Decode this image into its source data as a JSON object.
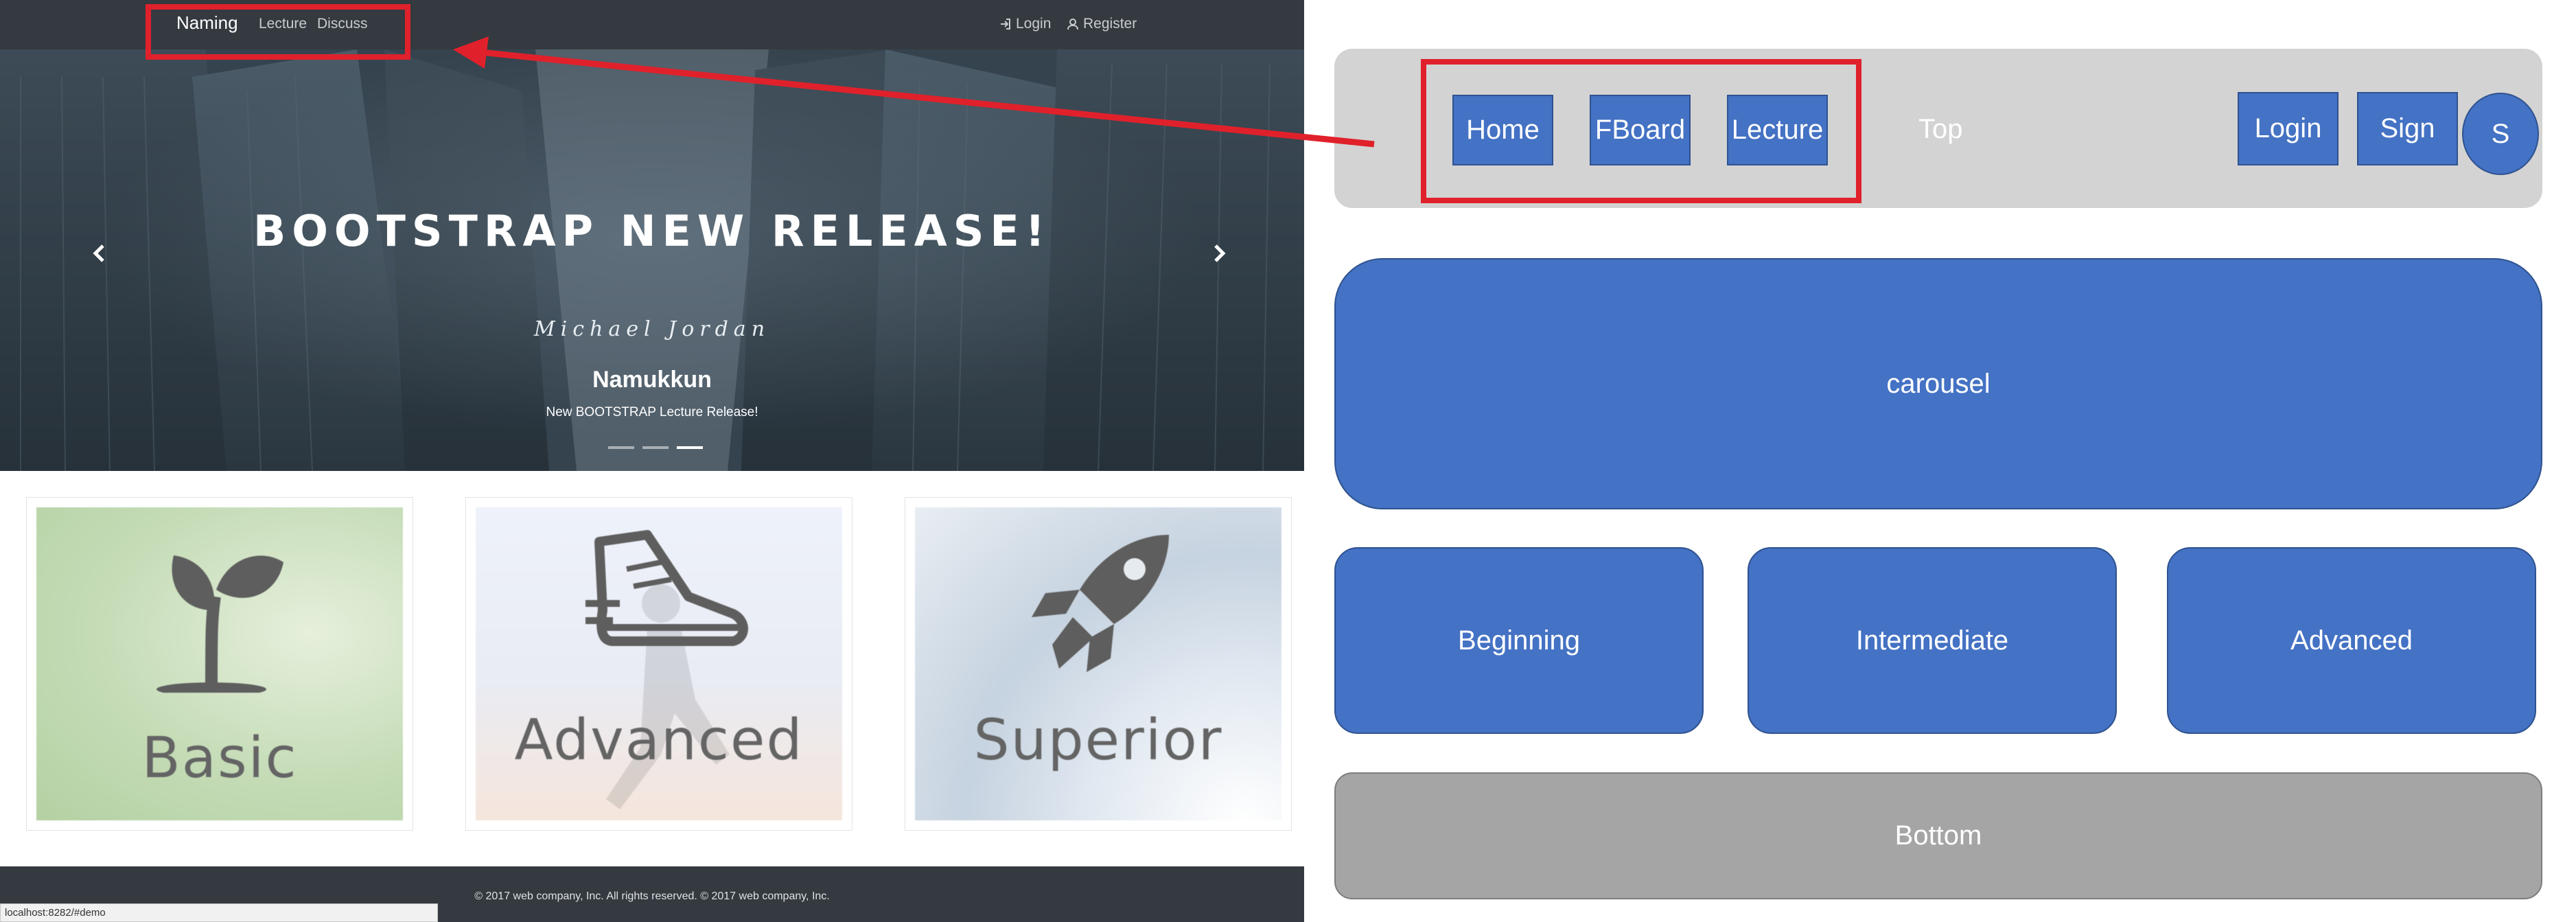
{
  "site": {
    "nav": {
      "brand": "Naming",
      "links": [
        "Lecture",
        "Discuss"
      ],
      "login": "Login",
      "register": "Register"
    },
    "carousel": {
      "title": "BOOTSTRAP NEW RELEASE!",
      "author": "Michael Jordan",
      "caption": "Namukkun",
      "subcaption": "New BOOTSTRAP Lecture Release!",
      "prev_icon": "chevron-left-icon",
      "next_icon": "chevron-right-icon",
      "slide_count": 3,
      "active_slide": 3
    },
    "cards": [
      {
        "label": "Basic",
        "icon": "sprout-icon",
        "tint": "#cfe3c2"
      },
      {
        "label": "Advanced",
        "icon": "sneaker-icon",
        "tint": "#eef0f7"
      },
      {
        "label": "Superior",
        "icon": "rocket-icon",
        "tint": "#d9e1ea"
      }
    ],
    "footer": {
      "text": "© 2017 web company, Inc.   All rights reserved.   © 2017 web company, Inc."
    },
    "status_url": "localhost:8282/#demo"
  },
  "wireframe": {
    "top": {
      "buttons": [
        "Home",
        "FBoard",
        "Lecture"
      ],
      "label": "Top",
      "right_buttons": [
        "Login",
        "Sign"
      ],
      "circle": "S"
    },
    "carousel_label": "carousel",
    "levels": [
      "Beginning",
      "Intermediate",
      "Advanced"
    ],
    "bottom_label": "Bottom"
  },
  "colors": {
    "navbar": "#343a40",
    "wire_blue": "#4472c4",
    "wire_top_gray": "#d3d3d3",
    "wire_bottom_gray": "#a5a5a5",
    "annotation_red": "#e0212b"
  }
}
